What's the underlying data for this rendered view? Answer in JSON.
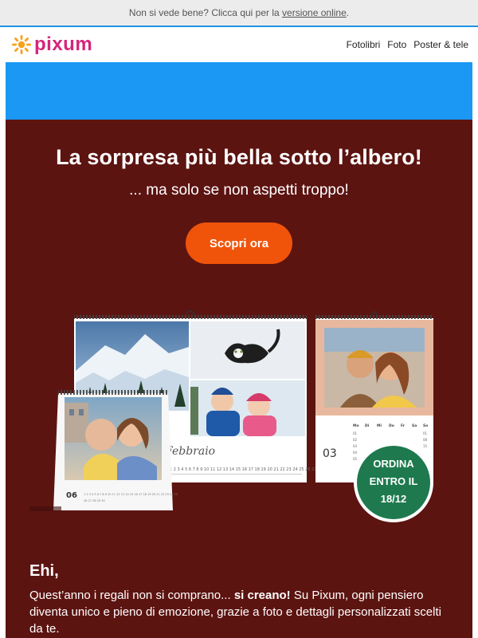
{
  "preheader": {
    "text_before": "Non si vede bene? Clicca qui per la ",
    "link_label": "versione online",
    "text_after": "."
  },
  "header": {
    "logo_text": "pixum",
    "nav": [
      "Fotolibri",
      "Foto",
      "Poster & tele"
    ]
  },
  "colors": {
    "brand_pink": "#d6247b",
    "logo_sun": "#f6a21c",
    "accent_blue": "#1b98f3",
    "hero_background": "#5c1411",
    "cta_orange": "#f0540a",
    "badge_green": "#1e7a4e"
  },
  "hero": {
    "title": "La sorpresa più bella sotto l’albero!",
    "subtitle": "... ma solo se non aspetti troppo!",
    "cta_label": "Scopri ora"
  },
  "calendars": {
    "wall_month_name": "Febbraio",
    "portrait_month_number": "03",
    "desk_month_number": "06",
    "weekday_headers": [
      "Mo",
      "Di",
      "Mi",
      "Do",
      "Fr",
      "Sa",
      "So"
    ]
  },
  "badge": {
    "line1": "ORDINA",
    "line2": "ENTRO IL",
    "line3": "18/12"
  },
  "content": {
    "greeting": "Ehi,",
    "para_start": "Quest’anno i regali non si comprano... ",
    "para_bold": "si creano!",
    "para_end": " Su Pixum, ogni pensiero diventa unico e pieno di emozione, grazie a foto e dettagli personalizzati scelti da te."
  }
}
